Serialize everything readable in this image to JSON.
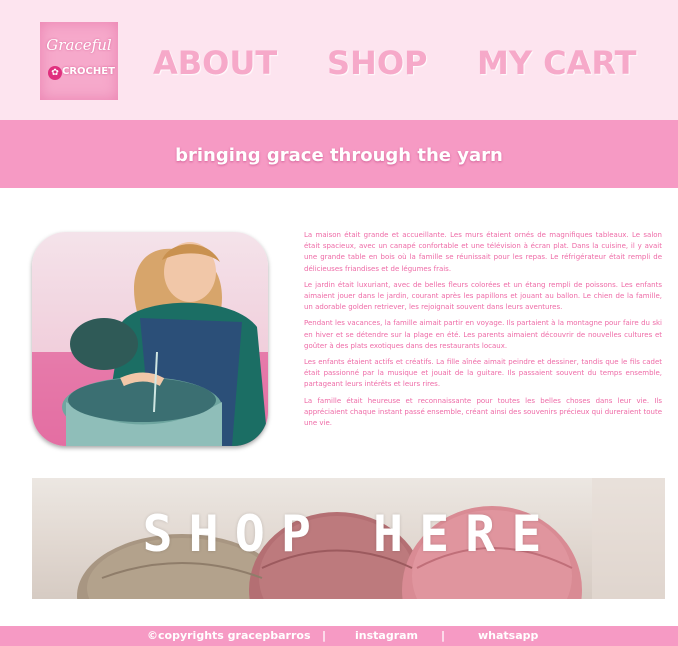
{
  "logo": {
    "script": "Graceful",
    "word": "CROCHET",
    "icon": "yarn-ball-icon"
  },
  "nav": {
    "about": "ABOUT",
    "shop": "SHOP",
    "cart": "MY CART"
  },
  "tagline": "bringing grace through the yarn",
  "article": {
    "p1": "La maison était grande et accueillante. Les murs étaient ornés de magnifiques tableaux. Le salon était spacieux, avec un canapé confortable et une télévision à écran plat. Dans la cuisine, il y avait une grande table en bois où la famille se réunissait pour les repas. Le réfrigérateur était rempli de délicieuses friandises et de légumes frais.",
    "p2": "Le jardin était luxuriant, avec de belles fleurs colorées et un étang rempli de poissons. Les enfants aimaient jouer dans le jardin, courant après les papillons et jouant au ballon. Le chien de la famille, un adorable golden retriever, les rejoignait souvent dans leurs aventures.",
    "p3": "Pendant les vacances, la famille aimait partir en voyage. Ils partaient à la montagne pour faire du ski en hiver et se détendre sur la plage en été. Les parents aimaient découvrir de nouvelles cultures et goûter à des plats exotiques dans des restaurants locaux.",
    "p4": "Les enfants étaient actifs et créatifs. La fille aînée aimait peindre et dessiner, tandis que le fils cadet était passionné par la musique et jouait de la guitare. Ils passaient souvent du temps ensemble, partageant leurs intérêts et leurs rires.",
    "p5": "La famille était heureuse et reconnaissante pour toutes les belles choses dans leur vie. Ils appréciaient chaque instant passé ensemble, créant ainsi des souvenirs précieux qui dureraient toute une vie."
  },
  "banner": {
    "text": "SHOP HERE"
  },
  "footer": {
    "copyright": "©copyrights gracepbarros",
    "separator": "|",
    "instagram": "instagram",
    "whatsapp": "whatsapp"
  },
  "colors": {
    "header_bg": "#fde4ef",
    "band_pink": "#f69ac4",
    "nav_pink": "#f6a9c9",
    "text_pink": "#ee6aa6"
  }
}
